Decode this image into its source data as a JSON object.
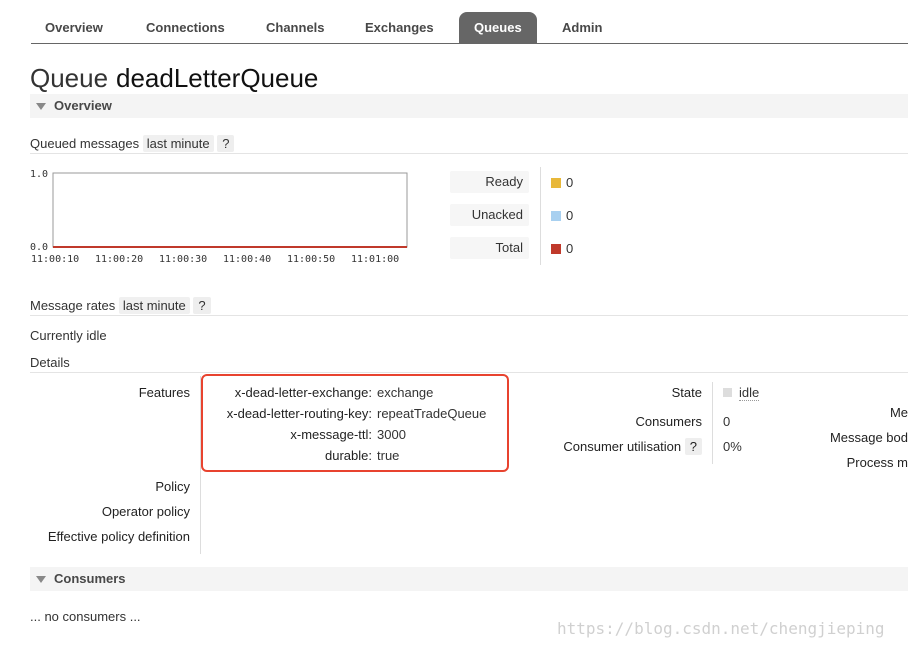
{
  "nav": {
    "tabs": [
      {
        "label": "Overview"
      },
      {
        "label": "Connections"
      },
      {
        "label": "Channels"
      },
      {
        "label": "Exchanges"
      },
      {
        "label": "Queues",
        "active": true
      },
      {
        "label": "Admin"
      }
    ]
  },
  "page": {
    "title_prefix": "Queue",
    "title_name": "deadLetterQueue"
  },
  "overview": {
    "section_label": "Overview",
    "queued_label": "Queued messages",
    "queued_range": "last minute",
    "help": "?",
    "rates_label": "Message rates",
    "rates_range": "last minute",
    "currently": "Currently idle",
    "details_label": "Details"
  },
  "chart_data": {
    "type": "line",
    "x": [
      "11:00:10",
      "11:00:20",
      "11:00:30",
      "11:00:40",
      "11:00:50",
      "11:01:00"
    ],
    "ytick_labels": [
      "1.0",
      "0.0"
    ],
    "ylim": [
      0,
      1
    ],
    "series": [
      {
        "name": "Ready",
        "values": [
          0,
          0,
          0,
          0,
          0,
          0
        ],
        "color": "#e8b83a"
      },
      {
        "name": "Unacked",
        "values": [
          0,
          0,
          0,
          0,
          0,
          0
        ],
        "color": "#a8d0f0"
      },
      {
        "name": "Total",
        "values": [
          0,
          0,
          0,
          0,
          0,
          0
        ],
        "color": "#c0392b"
      }
    ]
  },
  "legend": [
    {
      "label": "Ready",
      "value": "0",
      "color": "#e8b83a"
    },
    {
      "label": "Unacked",
      "value": "0",
      "color": "#a8d0f0"
    },
    {
      "label": "Total",
      "value": "0",
      "color": "#c0392b"
    }
  ],
  "details": {
    "features_label": "Features",
    "features": [
      {
        "key": "x-dead-letter-exchange:",
        "value": "exchange"
      },
      {
        "key": "x-dead-letter-routing-key:",
        "value": "repeatTradeQueue"
      },
      {
        "key": "x-message-ttl:",
        "value": "3000"
      },
      {
        "key": "durable:",
        "value": "true"
      }
    ],
    "policy_label": "Policy",
    "operator_policy_label": "Operator policy",
    "effective_policy_label": "Effective policy definition",
    "state_label": "State",
    "state_value": "idle",
    "consumers_label": "Consumers",
    "consumers_value": "0",
    "utilisation_label": "Consumer utilisation",
    "utilisation_value": "0%",
    "right_col": [
      "Me",
      "Message bod",
      "Process m"
    ]
  },
  "consumers": {
    "section_label": "Consumers",
    "empty_text": "... no consumers ..."
  },
  "watermark": "https://blog.csdn.net/chengjieping",
  "colors": {
    "highlight_box": "#e8432f",
    "active_tab": "#666666"
  }
}
